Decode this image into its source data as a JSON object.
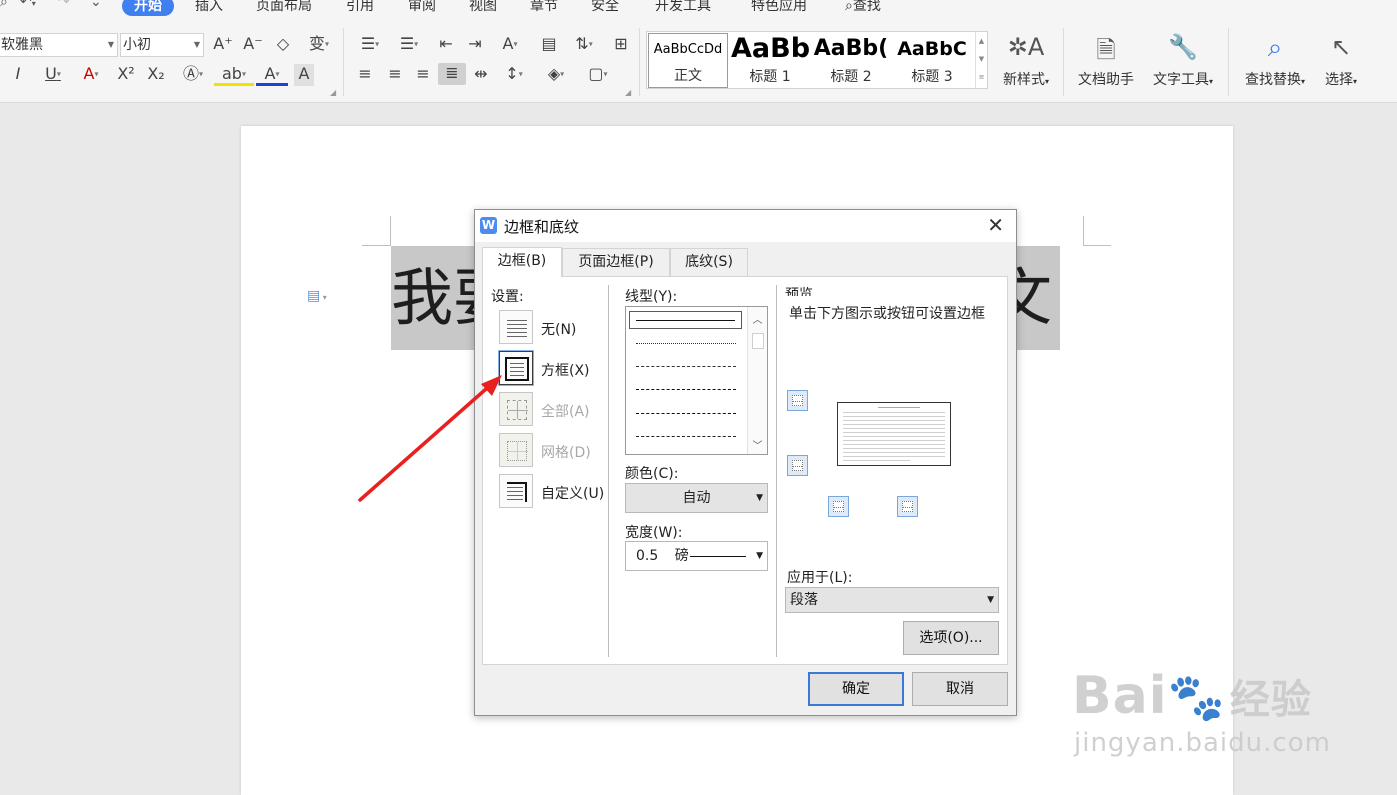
{
  "menu": {
    "items": [
      "开始",
      "插入",
      "页面布局",
      "引用",
      "审阅",
      "视图",
      "章节",
      "安全",
      "开发工具",
      "特色应用"
    ],
    "search_label": "查找"
  },
  "font": {
    "name": "软雅黑",
    "size": "小初"
  },
  "styles": [
    {
      "sample": "AaBbCcDd",
      "name": "正文"
    },
    {
      "sample": "AaBb",
      "name": "标题 1"
    },
    {
      "sample": "AaBb(",
      "name": "标题 2"
    },
    {
      "sample": "AaBbC",
      "name": "标题 3"
    }
  ],
  "ribbon_buttons": {
    "new_style": "新样式",
    "doc_assistant": "文档助手",
    "text_tools": "文字工具",
    "find_replace": "查找替换",
    "select": "选择"
  },
  "document": {
    "text_left": "我要",
    "text_right": "文"
  },
  "dialog": {
    "title": "边框和底纹",
    "tabs": [
      "边框(B)",
      "页面边框(P)",
      "底纹(S)"
    ],
    "settings_label": "设置:",
    "settings": [
      {
        "label": "无(N)",
        "enabled": true
      },
      {
        "label": "方框(X)",
        "enabled": true
      },
      {
        "label": "全部(A)",
        "enabled": false
      },
      {
        "label": "网格(D)",
        "enabled": false
      },
      {
        "label": "自定义(U)",
        "enabled": true
      }
    ],
    "line_style_label": "线型(Y):",
    "color_label": "颜色(C):",
    "color_value": "自动",
    "width_label": "宽度(W):",
    "width_value": "0.5",
    "width_unit": "磅",
    "preview_label": "预览",
    "preview_hint": "单击下方图示或按钮可设置边框",
    "apply_to_label": "应用于(L):",
    "apply_to_value": "段落",
    "options_button": "选项(O)...",
    "ok_button": "确定",
    "cancel_button": "取消"
  },
  "watermark": {
    "brand": "Bai",
    "brand_end": "经验",
    "url": "jingyan.baidu.com"
  },
  "colors": {
    "accent": "#3f7ff0",
    "arrow": "#e8201e",
    "selection_bg": "#c8c8c8"
  }
}
